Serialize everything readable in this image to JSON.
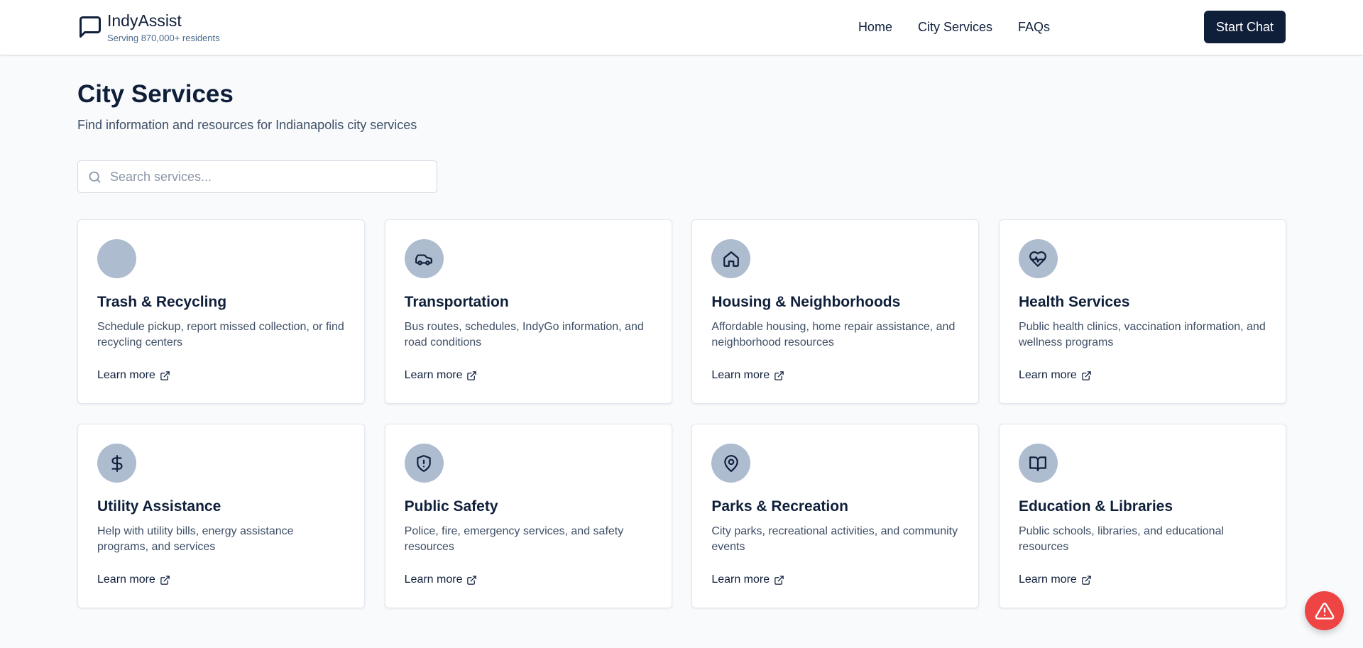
{
  "header": {
    "brand_name": "IndyAssist",
    "brand_tagline": "Serving 870,000+ residents",
    "nav": [
      {
        "label": "Home"
      },
      {
        "label": "City Services"
      },
      {
        "label": "FAQs"
      }
    ],
    "cta_label": "Start Chat"
  },
  "main": {
    "title": "City Services",
    "subtitle": "Find information and resources for Indianapolis city services",
    "search": {
      "placeholder": "Search services...",
      "value": ""
    }
  },
  "services": [
    {
      "title": "Trash & Recycling",
      "description": "Schedule pickup, report missed collection, or find recycling centers",
      "link": "Learn more",
      "icon": "none"
    },
    {
      "title": "Transportation",
      "description": "Bus routes, schedules, IndyGo information, and road conditions",
      "link": "Learn more",
      "icon": "car-icon"
    },
    {
      "title": "Housing & Neighborhoods",
      "description": "Affordable housing, home repair assistance, and neighborhood resources",
      "link": "Learn more",
      "icon": "home-icon"
    },
    {
      "title": "Health Services",
      "description": "Public health clinics, vaccination information, and wellness programs",
      "link": "Learn more",
      "icon": "heart-pulse-icon"
    },
    {
      "title": "Utility Assistance",
      "description": "Help with utility bills, energy assistance programs, and services",
      "link": "Learn more",
      "icon": "dollar-icon"
    },
    {
      "title": "Public Safety",
      "description": "Police, fire, emergency services, and safety resources",
      "link": "Learn more",
      "icon": "shield-alert-icon"
    },
    {
      "title": "Parks & Recreation",
      "description": "City parks, recreational activities, and community events",
      "link": "Learn more",
      "icon": "map-pin-icon"
    },
    {
      "title": "Education & Libraries",
      "description": "Public schools, libraries, and educational resources",
      "link": "Learn more",
      "icon": "book-open-icon"
    }
  ],
  "colors": {
    "primary": "#0f1f3a",
    "icon_circle": "#aebcd0",
    "page_bg": "#f8fafc",
    "alert": "#ef4444"
  },
  "floating": {
    "icon": "warning-icon"
  }
}
